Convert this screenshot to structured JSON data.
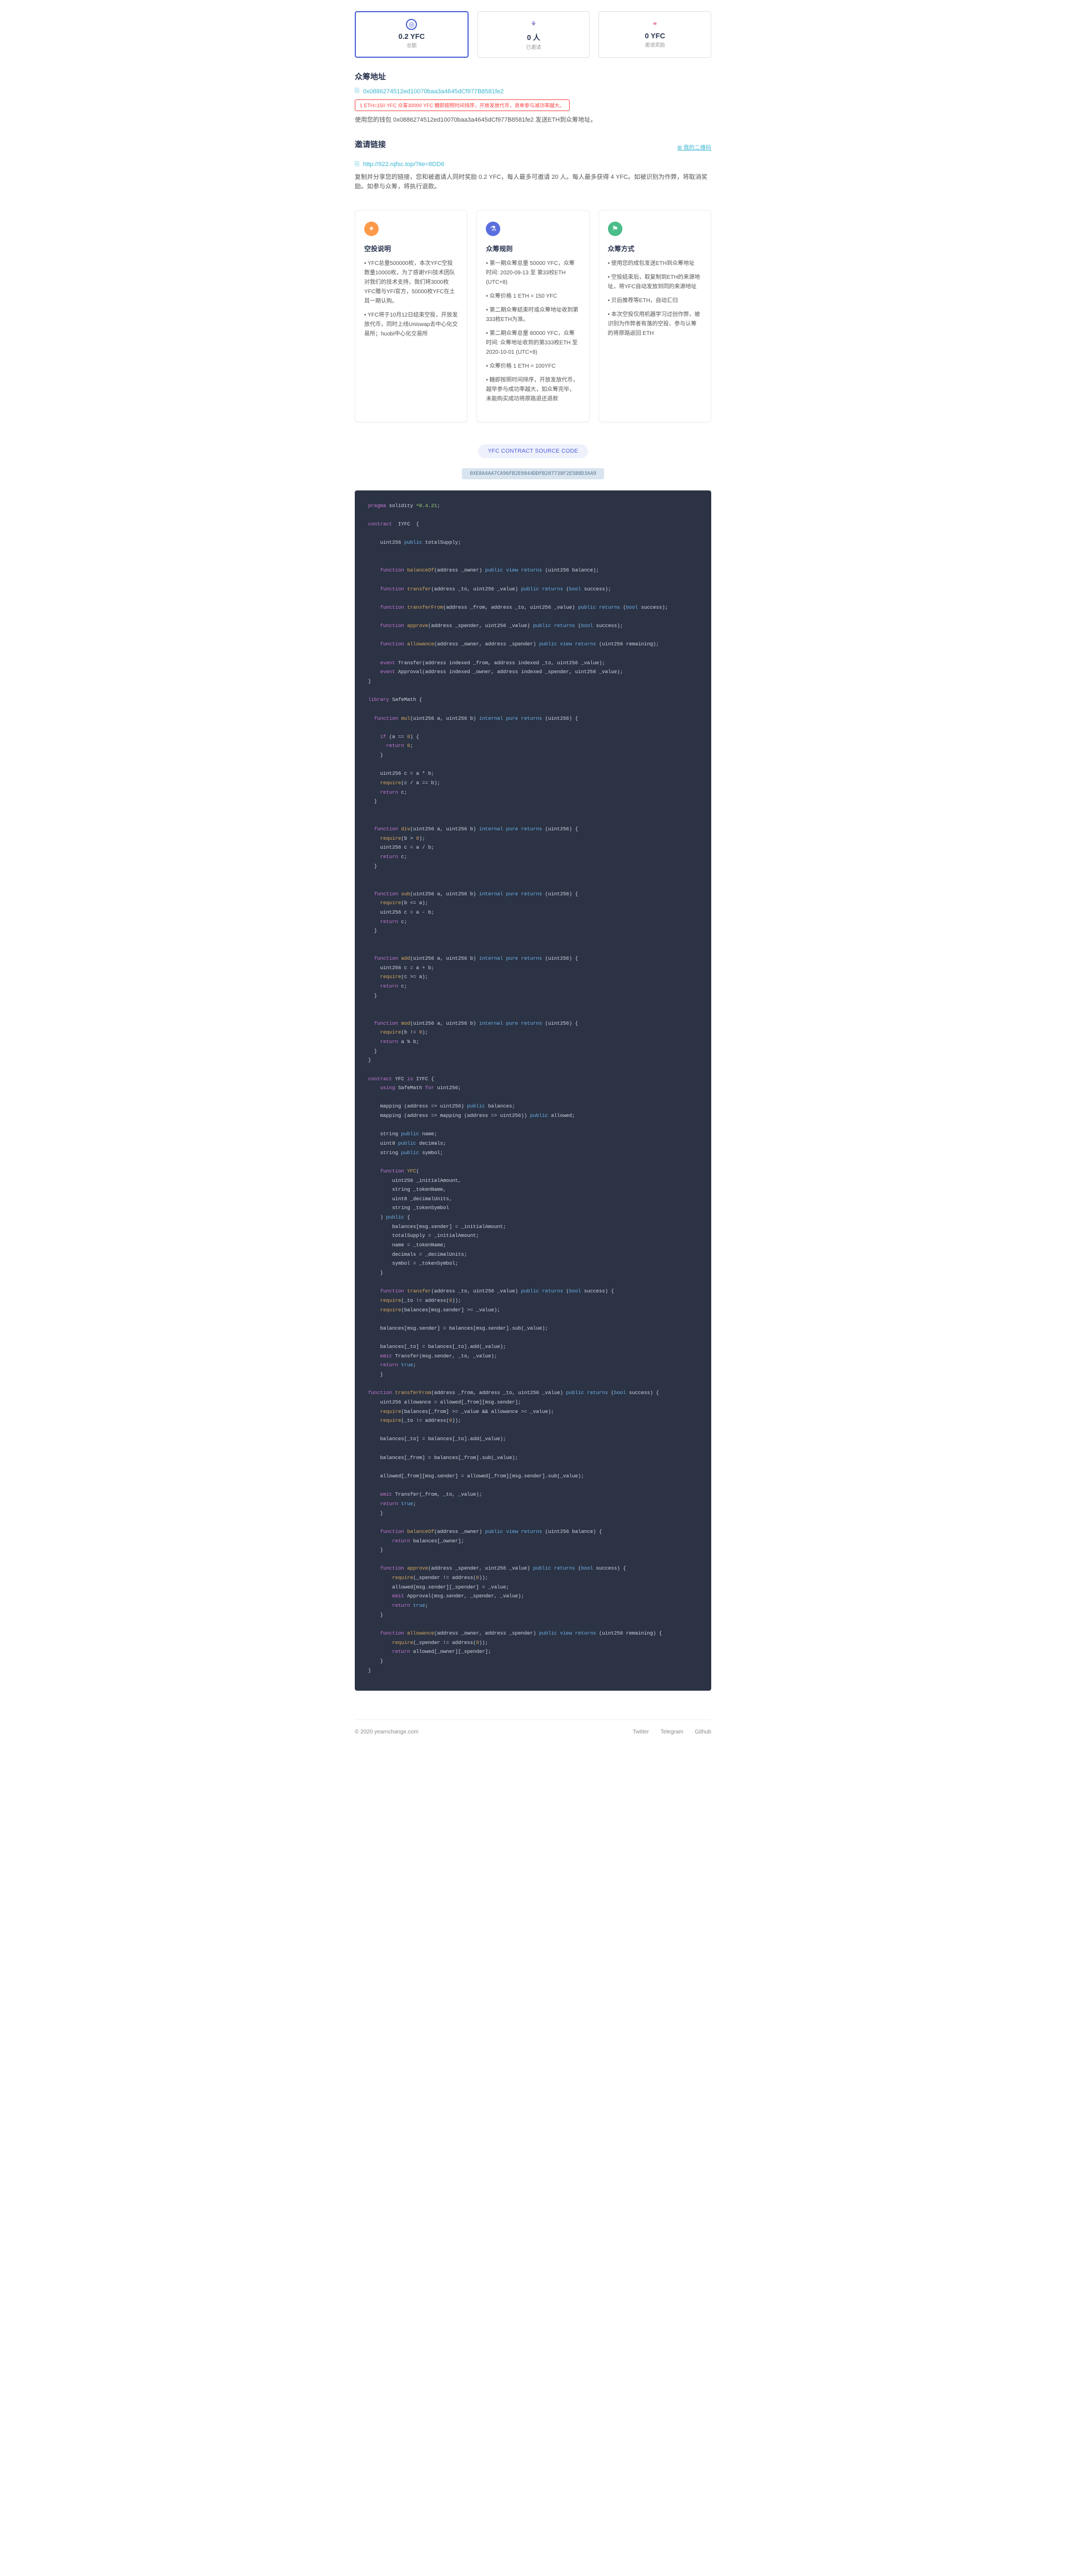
{
  "stats": [
    {
      "value": "0.2 YFC",
      "label": "总额",
      "icon": "◎"
    },
    {
      "value": "0 人",
      "label": "已邀请",
      "icon": "⚘"
    },
    {
      "value": "0 YFC",
      "label": "邀请奖励",
      "icon": "⚭"
    }
  ],
  "crowdfund": {
    "title": "众筹地址",
    "addr": "0x0886274512ed10070baa3a4645dCf977B8581fe2",
    "warning": "1 ETH=150 YFC 众筹30000 YFC 糖即按照时间排序，开放发放代币，退单参与减功率越大。",
    "desc": "使用您的钱包 0x0886274512ed10070baa3a4645dCf977B8581fe2 发送ETH到众筹地址。"
  },
  "invite": {
    "title": "邀请链接",
    "qr_label": "⊞ 我的二维码",
    "link": "http://922.rqfsc.top/?ite=8DD6",
    "desc": "复制并分享您的链接，您和被邀请人同时奖励 0.2 YFC，每人最多可邀请 20 人。每人最多获得 4 YFC。如被识别为作弊，将取消奖励。如参与众筹，将执行退款。"
  },
  "cards": [
    {
      "icon": "✦",
      "title": "空投说明",
      "items": [
        "• YFC总量500000枚，本次YFC空投数量10000枚，为了感谢YFI技术团队对我们的技术支持，我们将3000枚YFC赠与YFI官方，50000枚YFC在土耳一期认购。",
        "• YFC将于10月12日结束空投，开放发放代币，同时上线Uniswap去中心化交易所；huobi中心化交易所"
      ]
    },
    {
      "icon": "⚗",
      "title": "众筹规则",
      "items": [
        "• 第一期众筹总量 50000 YFC，众筹时间: 2020-09-13 至 第33校ETH (UTC+8)",
        "• 众筹价格 1 ETH = 150 YFC",
        "• 第二期众筹结束时或众筹地址收到第333枚ETH为准。",
        "• 第二期众筹总量 80000 YFC，众筹时间: 众筹地址收到的第333枚ETH 至 2020-10-01 (UTC+8)",
        "• 众筹价格 1 ETH = 100YFC",
        "• 糖即按照时间排序，开放发放代币，越早参与成功率越大，如众筹完毕，未能购买成功将原路退还退款"
      ]
    },
    {
      "icon": "⚑",
      "title": "众筹方式",
      "items": [
        "• 使用您的成包发送ETH到众筹地址",
        "• 空投结束后，取复制到ETH的来源地址，将YFC自动发放到同的来源地址",
        "• 贝后推荐等ETH，自动汇归",
        "• 本次空投仅用机器学习过创作弊，被识别为作弊者有落的空投、参与认筹的将原路返回 ETH"
      ]
    }
  ],
  "source_badge": "YFC CONTRACT SOURCE CODE",
  "contract_hash": "0XE8A4AA7CA96FB2E0844DDFB207738F2E5B8D3AA9",
  "footer": {
    "copyright": "© 2020 yearnchange.com",
    "links": [
      "Twitter",
      "Telegram",
      "Github"
    ]
  }
}
